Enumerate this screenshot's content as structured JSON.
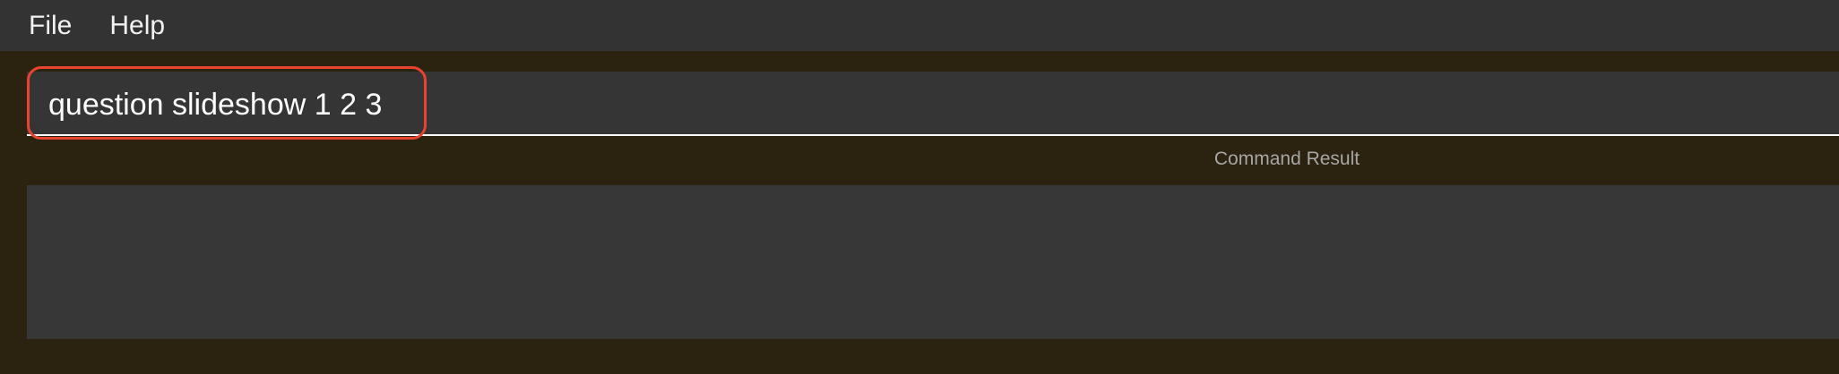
{
  "menu": {
    "items": [
      {
        "label": "File"
      },
      {
        "label": "Help"
      }
    ]
  },
  "command": {
    "value": "question slideshow 1 2 3",
    "placeholder": ""
  },
  "result": {
    "label": "Command Result",
    "text": ""
  },
  "colors": {
    "background": "#2b230f",
    "menubar": "#333333",
    "panel": "#373737",
    "highlight": "#e8432f"
  }
}
